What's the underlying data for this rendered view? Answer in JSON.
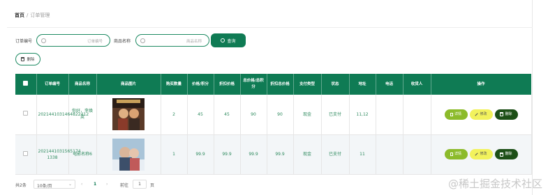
{
  "breadcrumb": {
    "home": "首页",
    "separator": "/",
    "current": "订单管理"
  },
  "search": {
    "order_no_label": "订单编号",
    "order_no_placeholder": "订单编号",
    "product_label": "商品名称",
    "product_placeholder": "商品名称",
    "search_button": "查询"
  },
  "toolbar": {
    "delete_label": "删除"
  },
  "table": {
    "headers": [
      "订单编号",
      "商品名称",
      "商品图片",
      "购买数量",
      "价格/积分",
      "折扣价格",
      "总价格/总积分",
      "折扣总价格",
      "支付类型",
      "状态",
      "地址",
      "电话",
      "收货人",
      "操作"
    ],
    "rows": [
      {
        "order_no": "2021441031464822412",
        "product": "你好，李焕英",
        "qty": "2",
        "price": "45",
        "discount_price": "45",
        "total": "90",
        "discount_total": "90",
        "pay_type": "现金",
        "status": "已支付",
        "address": "11,12",
        "phone": "",
        "receiver": ""
      },
      {
        "order_no": "2021441031565174 1338",
        "product": "电影名称6",
        "qty": "1",
        "price": "99.9",
        "discount_price": "99.9",
        "total": "99.9",
        "discount_total": "99.9",
        "pay_type": "现金",
        "status": "已支付",
        "address": "11",
        "phone": "",
        "receiver": ""
      }
    ],
    "actions": {
      "detail": "详情",
      "edit": "修改",
      "delete": "删除"
    }
  },
  "pager": {
    "total": "共2条",
    "page_size": "10条/页",
    "prev": "‹",
    "page": "1",
    "next": "›",
    "goto_label": "前往",
    "goto_value": "1",
    "page_unit": "页"
  },
  "watermark": "@稀土掘金技术社区",
  "colors": {
    "primary": "#0f7b54",
    "detail": "#8cbb2b",
    "edit": "#f2f25c",
    "delete": "#1c4f16"
  }
}
